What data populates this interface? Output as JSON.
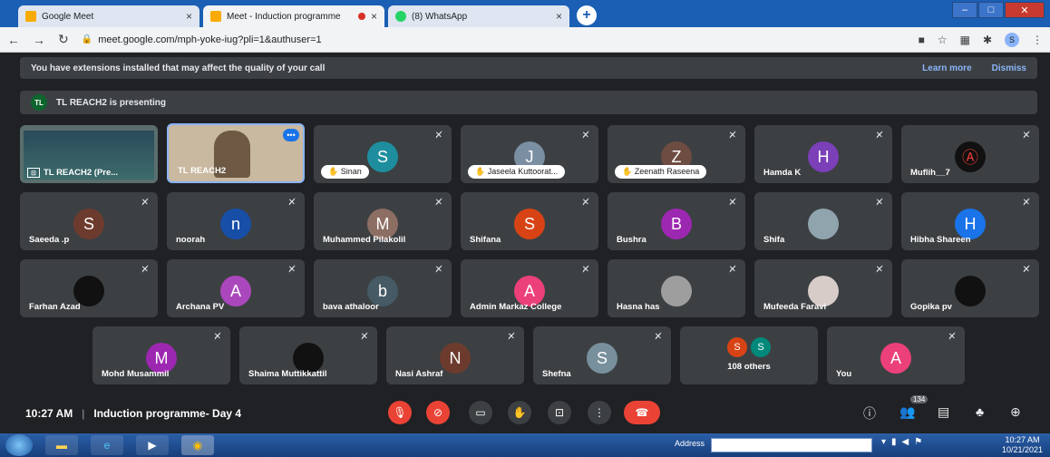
{
  "browser": {
    "tabs": [
      {
        "title": "Google Meet",
        "close": "×",
        "favicon_color": "#f9ab00"
      },
      {
        "title": "Meet - Induction programme",
        "close": "×",
        "favicon_color": "#f9ab00"
      },
      {
        "title": "(8) WhatsApp",
        "close": "×",
        "favicon_color": "#25d366"
      }
    ],
    "new_tab": "+",
    "window_controls": [
      "–",
      "□",
      "✕"
    ],
    "url": "meet.google.com/mph-yoke-iug?pli=1&authuser=1",
    "profile_initial": "S"
  },
  "extension_banner": {
    "text": "You have extensions installed that may affect the quality of your call",
    "learn_more": "Learn more",
    "dismiss": "Dismiss"
  },
  "presenting_banner": {
    "badge": "TL",
    "text": "TL REACH2 is presenting"
  },
  "tiles": {
    "screen": {
      "label": "TL REACH2 (Pre...",
      "icon_label": "⊡"
    },
    "camera": {
      "label": "TL REACH2",
      "more": "•••"
    },
    "row1": [
      {
        "initial": "S",
        "name": "Sinan",
        "color": "#1e8e9e",
        "hand": true
      },
      {
        "initial": "J",
        "name": "Jaseela Kuttoorat...",
        "color": "#7b8fa3",
        "hand": true
      },
      {
        "initial": "Z",
        "name": "Zeenath Raseena",
        "color": "#6d4c41",
        "hand": true
      },
      {
        "initial": "H",
        "name": "Hamda K",
        "color": "#7b3fb8"
      },
      {
        "initial": "",
        "name": "Muflih__7",
        "color": "#111111",
        "logo": "Ⓐ"
      }
    ],
    "row2": [
      {
        "initial": "S",
        "name": "Saeeda .p",
        "color": "#6d3b2e"
      },
      {
        "initial": "n",
        "name": "noorah",
        "color": "#174ea6"
      },
      {
        "initial": "M",
        "name": "Muhammed Pilakolil",
        "color": "#8d6e63"
      },
      {
        "initial": "S",
        "name": "Shifana",
        "color": "#d84315"
      },
      {
        "initial": "B",
        "name": "Bushra",
        "color": "#9c27b0"
      },
      {
        "initial": "",
        "name": "Shifa",
        "color": "#90a4ae",
        "photo": true
      },
      {
        "initial": "H",
        "name": "Hibha Shareen",
        "color": "#1a73e8"
      }
    ],
    "row3": [
      {
        "initial": "",
        "name": "Farhan Azad",
        "color": "#111111"
      },
      {
        "initial": "A",
        "name": "Archana PV",
        "color": "#ab47bc"
      },
      {
        "initial": "b",
        "name": "bava athaloor",
        "color": "#455a64"
      },
      {
        "initial": "A",
        "name": "Admin Markaz College",
        "color": "#ec407a"
      },
      {
        "initial": "",
        "name": "Hasna has",
        "color": "#9e9e9e",
        "photo": true
      },
      {
        "initial": "",
        "name": "Mufeeda Faravi",
        "color": "#d7ccc8",
        "photo": true
      },
      {
        "initial": "",
        "name": "Gopika pv",
        "color": "#111111"
      }
    ],
    "row4": [
      {
        "initial": "M",
        "name": "Mohd Musammil",
        "color": "#9c27b0"
      },
      {
        "initial": "",
        "name": "Shaima Muttikkattil",
        "color": "#111111"
      },
      {
        "initial": "N",
        "name": "Nasi Ashraf",
        "color": "#6d3b2e"
      },
      {
        "initial": "S",
        "name": "Shefna",
        "color": "#78909c"
      }
    ],
    "others": {
      "initials": [
        "S",
        "S"
      ],
      "colors": [
        "#d84315",
        "#00897b"
      ],
      "label": "108 others"
    },
    "you": {
      "initial": "A",
      "name": "You",
      "color": "#ec407a"
    }
  },
  "controls": {
    "time": "10:27 AM",
    "separator": "|",
    "meeting_name": "Induction programme- Day 4",
    "people_count": "134"
  },
  "taskbar": {
    "address_label": "Address",
    "clock_time": "10:27 AM",
    "clock_date": "10/21/2021"
  }
}
